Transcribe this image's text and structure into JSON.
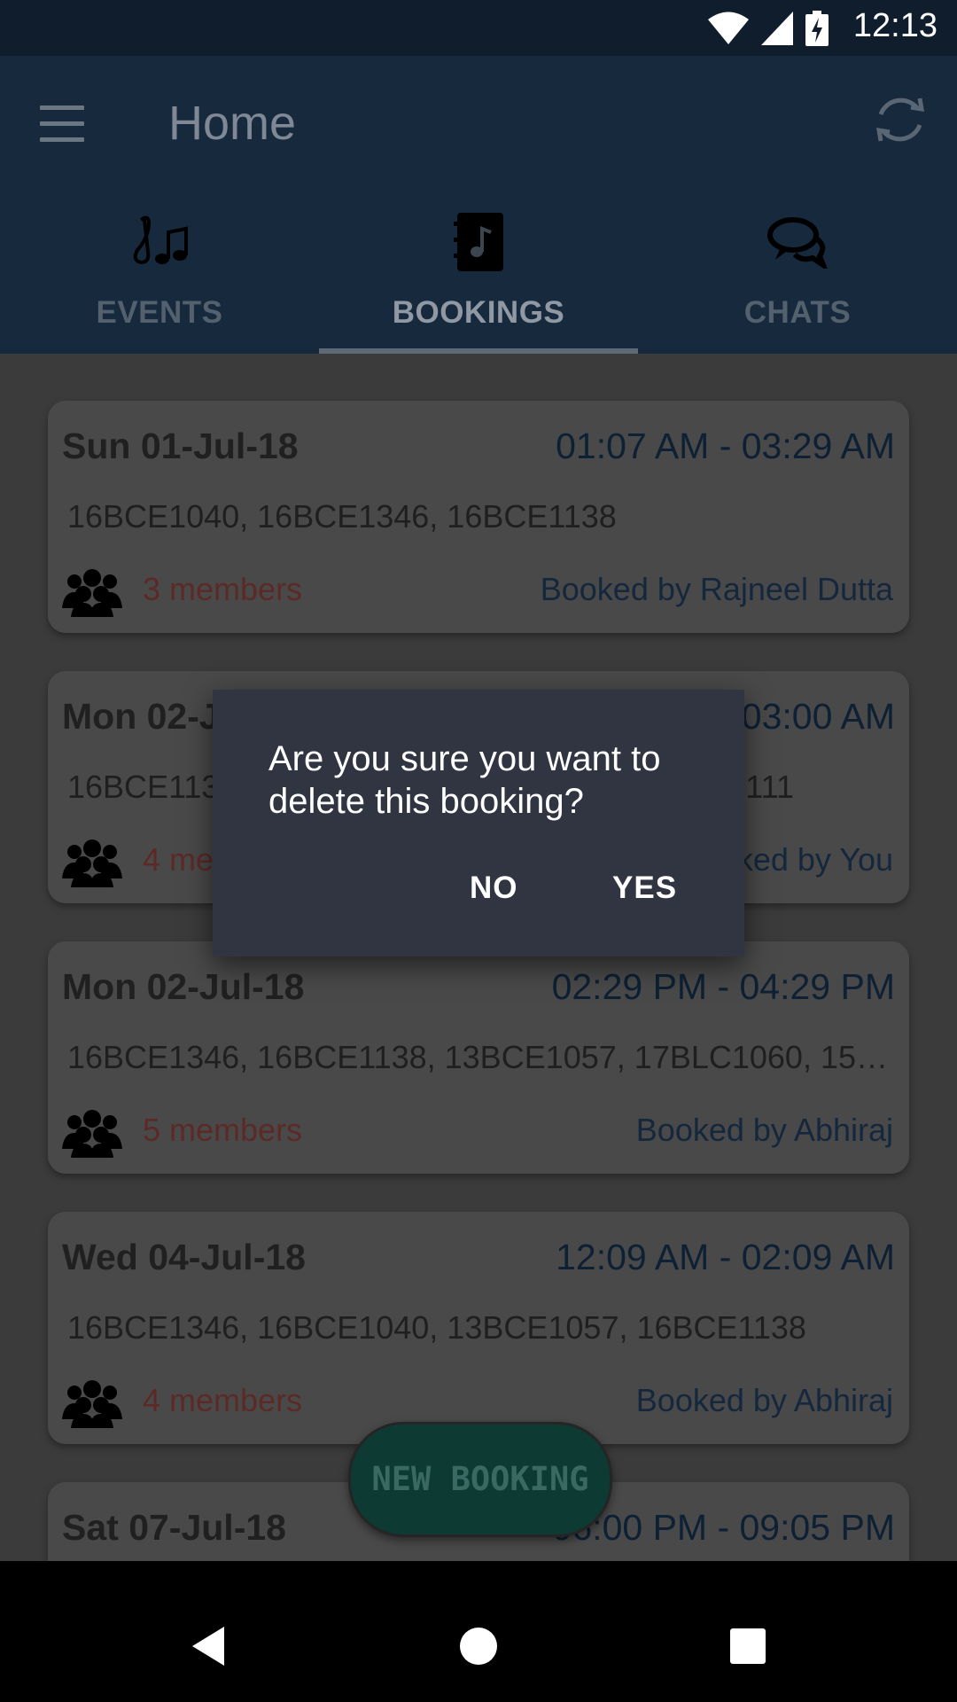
{
  "status_bar": {
    "time": "12:13",
    "icons": [
      "wifi-icon",
      "signal-icon",
      "battery-charging-icon"
    ]
  },
  "app_bar": {
    "title": "Home",
    "menu_icon": "menu-icon",
    "refresh_icon": "refresh-icon",
    "tabs": [
      {
        "label": "EVENTS",
        "icon": "music-notes-icon",
        "selected": false
      },
      {
        "label": "BOOKINGS",
        "icon": "music-book-icon",
        "selected": true
      },
      {
        "label": "CHATS",
        "icon": "chat-bubbles-icon",
        "selected": false
      }
    ]
  },
  "bookings": [
    {
      "date": "Sun 01-Jul-18",
      "time": "01:07 AM - 03:29 AM",
      "members": "16BCE1040, 16BCE1346, 16BCE1138",
      "count": "3 members",
      "booked_by": "Booked by Rajneel Dutta"
    },
    {
      "date": "Mon 02-J",
      "time": "03:00 AM",
      "members": "16BCE113",
      "members_tail": "111",
      "count": "4 me",
      "booked_by": "ked by You"
    },
    {
      "date": "Mon 02-Jul-18",
      "time": "02:29 PM - 04:29 PM",
      "members": "16BCE1346, 16BCE1138, 13BCE1057, 17BLC1060, 15B…",
      "count": "5 members",
      "booked_by": "Booked by Abhiraj"
    },
    {
      "date": "Wed 04-Jul-18",
      "time": "12:09 AM - 02:09 AM",
      "members": "16BCE1346, 16BCE1040, 13BCE1057, 16BCE1138",
      "count": "4 members",
      "booked_by": "Booked by Abhiraj"
    },
    {
      "date": "Sat 07-Jul-18",
      "time": "06:00 PM - 09:05 PM"
    }
  ],
  "fab": {
    "label": "NEW BOOKING"
  },
  "dialog": {
    "message": "Are you sure you want to delete this booking?",
    "no_label": "NO",
    "yes_label": "YES"
  },
  "nav_bar": {
    "icons": [
      "back-icon",
      "home-icon",
      "recents-icon"
    ]
  },
  "colors": {
    "app_bar": "#16293d",
    "status_bar": "#0f1d2c",
    "dialog": "#313542",
    "fab": "#0e3a34",
    "member_count": "#c0392b"
  }
}
